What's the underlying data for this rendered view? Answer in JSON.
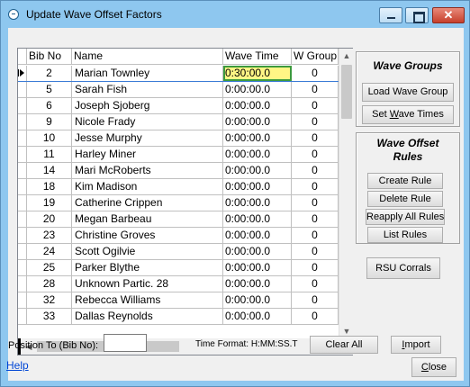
{
  "window": {
    "title": "Update Wave Offset Factors",
    "controls": {
      "minimize": "—",
      "maximize": "□",
      "close": "✕"
    }
  },
  "grid": {
    "columns": [
      "Bib No",
      "Name",
      "Wave Time",
      "W Group"
    ],
    "rows": [
      {
        "bib": "2",
        "name": "Marian Townley",
        "wave": "0:30:00.0",
        "group": "0"
      },
      {
        "bib": "5",
        "name": "Sarah Fish",
        "wave": "0:00:00.0",
        "group": "0"
      },
      {
        "bib": "6",
        "name": "Joseph Sjoberg",
        "wave": "0:00:00.0",
        "group": "0"
      },
      {
        "bib": "9",
        "name": "Nicole Frady",
        "wave": "0:00:00.0",
        "group": "0"
      },
      {
        "bib": "10",
        "name": "Jesse Murphy",
        "wave": "0:00:00.0",
        "group": "0"
      },
      {
        "bib": "11",
        "name": "Harley Miner",
        "wave": "0:00:00.0",
        "group": "0"
      },
      {
        "bib": "14",
        "name": "Mari McRoberts",
        "wave": "0:00:00.0",
        "group": "0"
      },
      {
        "bib": "18",
        "name": "Kim Madison",
        "wave": "0:00:00.0",
        "group": "0"
      },
      {
        "bib": "19",
        "name": "Catherine Crippen",
        "wave": "0:00:00.0",
        "group": "0"
      },
      {
        "bib": "20",
        "name": "Megan Barbeau",
        "wave": "0:00:00.0",
        "group": "0"
      },
      {
        "bib": "23",
        "name": "Christine Groves",
        "wave": "0:00:00.0",
        "group": "0"
      },
      {
        "bib": "24",
        "name": "Scott Ogilvie",
        "wave": "0:00:00.0",
        "group": "0"
      },
      {
        "bib": "25",
        "name": "Parker Blythe",
        "wave": "0:00:00.0",
        "group": "0"
      },
      {
        "bib": "28",
        "name": "Unknown Partic. 28",
        "wave": "0:00:00.0",
        "group": "0"
      },
      {
        "bib": "32",
        "name": "Rebecca Williams",
        "wave": "0:00:00.0",
        "group": "0"
      },
      {
        "bib": "33",
        "name": "Dallas Reynolds",
        "wave": "0:00:00.0",
        "group": "0"
      }
    ],
    "current_row_index": 0
  },
  "wave_groups": {
    "title": "Wave Groups",
    "load_label": "Load Wave Group",
    "set_label_pre": "Set ",
    "set_label_ul": "W",
    "set_label_post": "ave Times"
  },
  "wave_rules": {
    "title_line1": "Wave Offset",
    "title_line2": "Rules",
    "create_label": "Create Rule",
    "delete_label": "Delete Rule",
    "reapply_label": "Reapply All Rules",
    "list_label": "List Rules"
  },
  "rsu_label": "RSU Corrals",
  "position_label": "Position To (Bib No):",
  "position_value": "",
  "time_format_label": "Time Format: H:MM:SS.T",
  "clear_all_label": "Clear All",
  "import_pre": "",
  "import_ul": "I",
  "import_post": "mport",
  "close_pre": "",
  "close_ul": "C",
  "close_post": "lose",
  "help_label": "Help"
}
